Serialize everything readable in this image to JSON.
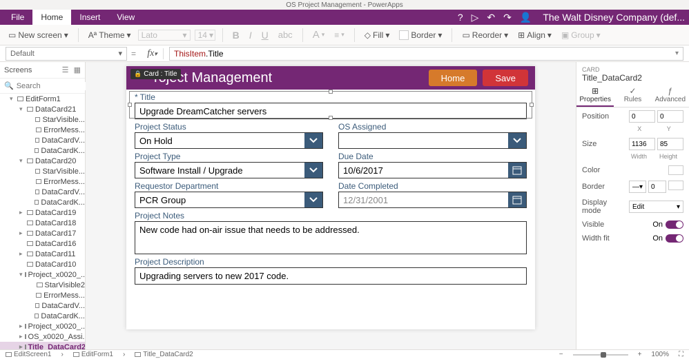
{
  "window_title": "OS Project Management - PowerApps",
  "company": "The Walt Disney Company (def...",
  "ribbon_tabs": {
    "file": "File",
    "home": "Home",
    "insert": "Insert",
    "view": "View"
  },
  "ribbon": {
    "new_screen": "New screen",
    "theme": "Theme",
    "font_name": "Lato",
    "font_size": "14",
    "fill": "Fill",
    "border": "Border",
    "reorder": "Reorder",
    "align": "Align",
    "group": "Group"
  },
  "name_box": "Default",
  "formula": {
    "obj": "ThisItem",
    "dot": ".",
    "prop": "Title"
  },
  "screens_label": "Screens",
  "search_placeholder": "Search",
  "tree": [
    {
      "ind": 1,
      "exp": "▾",
      "label": "EditForm1"
    },
    {
      "ind": 2,
      "exp": "▾",
      "label": "DataCard21"
    },
    {
      "ind": 3,
      "exp": "",
      "label": "StarVisible..."
    },
    {
      "ind": 3,
      "exp": "",
      "label": "ErrorMess..."
    },
    {
      "ind": 3,
      "exp": "",
      "label": "DataCardV..."
    },
    {
      "ind": 3,
      "exp": "",
      "label": "DataCardK..."
    },
    {
      "ind": 2,
      "exp": "▾",
      "label": "DataCard20"
    },
    {
      "ind": 3,
      "exp": "",
      "label": "StarVisible..."
    },
    {
      "ind": 3,
      "exp": "",
      "label": "ErrorMess..."
    },
    {
      "ind": 3,
      "exp": "",
      "label": "DataCardV..."
    },
    {
      "ind": 3,
      "exp": "",
      "label": "DataCardK..."
    },
    {
      "ind": 2,
      "exp": "▸",
      "label": "DataCard19"
    },
    {
      "ind": 2,
      "exp": "",
      "label": "DataCard18"
    },
    {
      "ind": 2,
      "exp": "▸",
      "label": "DataCard17"
    },
    {
      "ind": 2,
      "exp": "",
      "label": "DataCard16"
    },
    {
      "ind": 2,
      "exp": "▸",
      "label": "DataCard11"
    },
    {
      "ind": 2,
      "exp": "",
      "label": "DataCard10"
    },
    {
      "ind": 2,
      "exp": "▾",
      "label": "Project_x0020_..."
    },
    {
      "ind": 3,
      "exp": "",
      "label": "StarVisible2"
    },
    {
      "ind": 3,
      "exp": "",
      "label": "ErrorMess..."
    },
    {
      "ind": 3,
      "exp": "",
      "label": "DataCardV..."
    },
    {
      "ind": 3,
      "exp": "",
      "label": "DataCardK..."
    },
    {
      "ind": 2,
      "exp": "▸",
      "label": "Project_x0020_..."
    },
    {
      "ind": 2,
      "exp": "▸",
      "label": "OS_x0020_Assi..."
    },
    {
      "ind": 2,
      "exp": "▸",
      "label": "Title_DataCard2",
      "selected": true
    }
  ],
  "card_tag": "Card : Title",
  "app": {
    "title": "roject Management",
    "home_btn": "Home",
    "save_btn": "Save",
    "fields": {
      "title_label": "Title",
      "title_value": "Upgrade DreamCatcher servers",
      "status_label": "Project Status",
      "status_value": "On Hold",
      "assigned_label": "OS Assigned",
      "assigned_value": "",
      "type_label": "Project Type",
      "type_value": "Software Install / Upgrade",
      "due_label": "Due Date",
      "due_value": "10/6/2017",
      "dept_label": "Requestor Department",
      "dept_value": "PCR Group",
      "completed_label": "Date Completed",
      "completed_placeholder": "12/31/2001",
      "notes_label": "Project Notes",
      "notes_value": "New code had on-air issue that needs to be addressed.",
      "desc_label": "Project Description",
      "desc_value": "Upgrading servers to new 2017 code."
    }
  },
  "props": {
    "card_label": "CARD",
    "card_name": "Title_DataCard2",
    "tabs": {
      "properties": "Properties",
      "rules": "Rules",
      "advanced": "Advanced"
    },
    "position_label": "Position",
    "pos_x": "0",
    "pos_y": "0",
    "x_label": "X",
    "y_label": "Y",
    "size_label": "Size",
    "width": "1136",
    "height": "85",
    "w_label": "Width",
    "h_label": "Height",
    "color_label": "Color",
    "border_label": "Border",
    "border_weight": "0",
    "display_label": "Display mode",
    "display_value": "Edit",
    "visible_label": "Visible",
    "widthfit_label": "Width fit",
    "on_label": "On"
  },
  "breadcrumbs": {
    "screen": "EditScreen1",
    "form": "EditForm1",
    "card": "Title_DataCard2"
  },
  "zoom": "100%"
}
